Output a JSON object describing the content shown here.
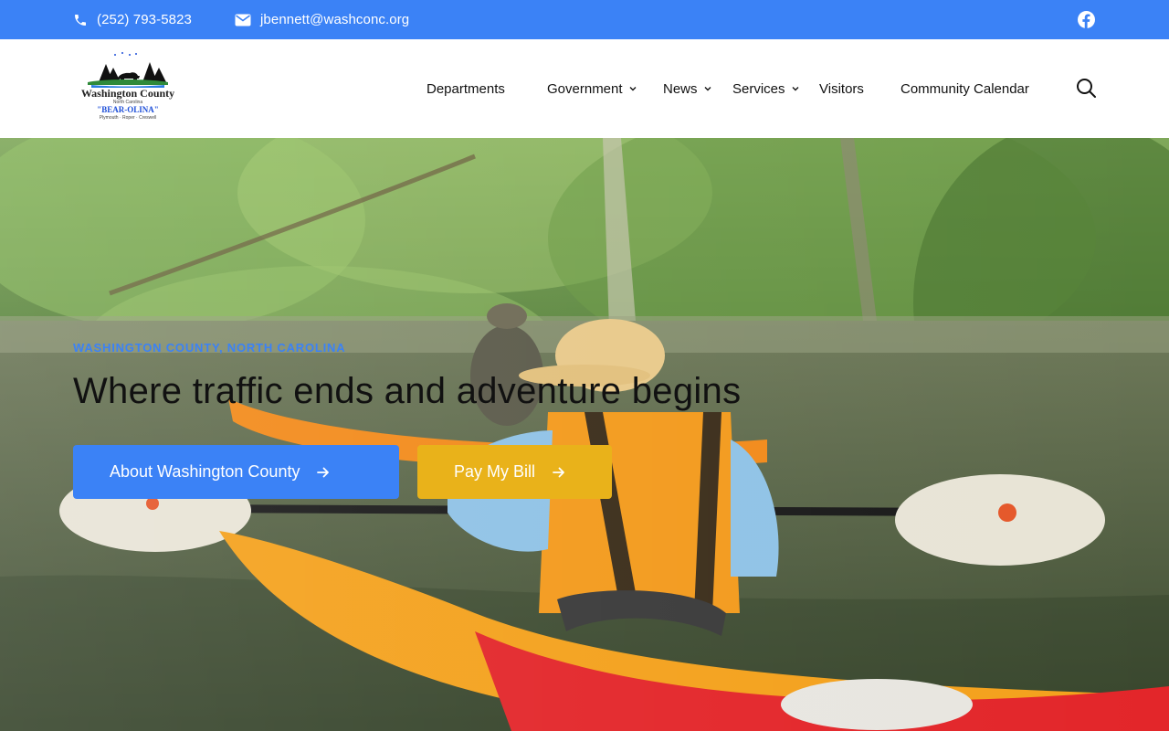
{
  "topbar": {
    "phone": "(252) 793-5823",
    "email": "jbennett@washconc.org",
    "social_icon": "facebook-icon",
    "background": "#3b82f6"
  },
  "header": {
    "logo": {
      "line1": "Washington County",
      "line2": "North Carolina",
      "line3": "\"BEAR-OLINA\"",
      "line4": "Plymouth · Roper · Creswell"
    },
    "nav": [
      {
        "label": "Departments",
        "has_dropdown": false
      },
      {
        "label": "Government",
        "has_dropdown": true
      },
      {
        "label": "News",
        "has_dropdown": true
      },
      {
        "label": "Services",
        "has_dropdown": true
      },
      {
        "label": "Visitors",
        "has_dropdown": false
      },
      {
        "label": "Community Calendar",
        "has_dropdown": false
      }
    ],
    "search_icon": "search-icon"
  },
  "hero": {
    "eyebrow": "WASHINGTON COUNTY, NORTH CAROLINA",
    "headline": "Where traffic ends and adventure begins",
    "buttons": [
      {
        "label": "About Washington County",
        "color": "#3b82f6"
      },
      {
        "label": "Pay My Bill",
        "color": "#e9b21a"
      }
    ]
  },
  "colors": {
    "accent": "#3b82f6",
    "secondary": "#e9b21a"
  }
}
